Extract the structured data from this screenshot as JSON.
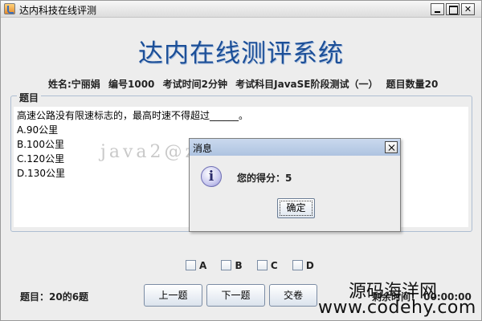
{
  "window": {
    "title": "达内科技在线评测",
    "banner": "达内在线测评系统"
  },
  "info": {
    "name": "姓名:宁丽娟",
    "id": "编号1000",
    "time": "考试时间2分钟",
    "subject": "考试科目JavaSE阶段测试（一）",
    "count": "题目数量20"
  },
  "question_panel": {
    "legend": "题目",
    "stem": "高速公路没有限速标志的，最高时速不得超过______。",
    "choices": [
      "A.90公里",
      "B.100公里",
      "C.120公里",
      "D.130公里"
    ]
  },
  "watermark_text": "java2@zuidaima.com",
  "dialog": {
    "title": "消息",
    "icon": "information-icon",
    "message": "您的得分：5",
    "ok_label": "确定"
  },
  "answers": {
    "options": [
      "A",
      "B",
      "C",
      "D"
    ]
  },
  "footer": {
    "progress": "题目：20的6题",
    "prev_label": "上一题",
    "next_label": "下一题",
    "submit_label": "交卷",
    "timer_visible": "剩余时间： 00:00:00"
  },
  "overlay_watermark": {
    "line1": "源码海洋网",
    "line2": "www.codehy.com"
  },
  "colors": {
    "banner": "#1c4f98",
    "dialog_title": "#aec3e0",
    "window_bg": "#ededed"
  }
}
